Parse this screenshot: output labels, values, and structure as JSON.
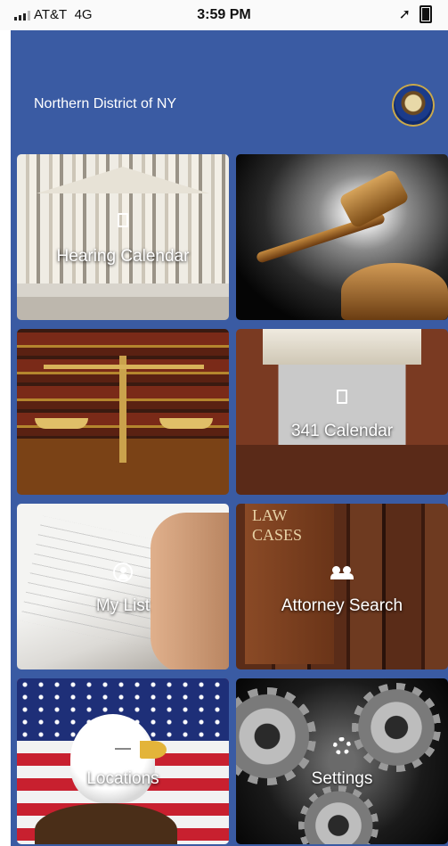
{
  "status_bar": {
    "carrier": "AT&T",
    "network": "4G",
    "time": "3:59 PM",
    "location_icon": "location-arrow-icon",
    "battery_icon": "battery-icon"
  },
  "header": {
    "title": "Northern District of NY",
    "seal_icon": "us-seal-icon"
  },
  "colors": {
    "app_background": "#3a5ba3",
    "label_text": "#ffffff"
  },
  "tiles": [
    {
      "id": "hearing-calendar",
      "label": "Hearing Calendar",
      "icon": "calendar-icon"
    },
    {
      "id": "gavel",
      "label": ""
    },
    {
      "id": "scales",
      "label": ""
    },
    {
      "id": "341-calendar",
      "label": "341 Calendar"
    },
    {
      "id": "my-list",
      "label": "My List",
      "icon": "user-icon"
    },
    {
      "id": "attorney-search",
      "label": "Attorney Search",
      "icon": "users-icon"
    },
    {
      "id": "locations",
      "label": "Locations",
      "icon": "envelope-icon"
    },
    {
      "id": "settings",
      "label": "Settings",
      "icon": "gear-icon"
    }
  ],
  "attorney_tile_text": [
    "LAW",
    "CASES"
  ]
}
